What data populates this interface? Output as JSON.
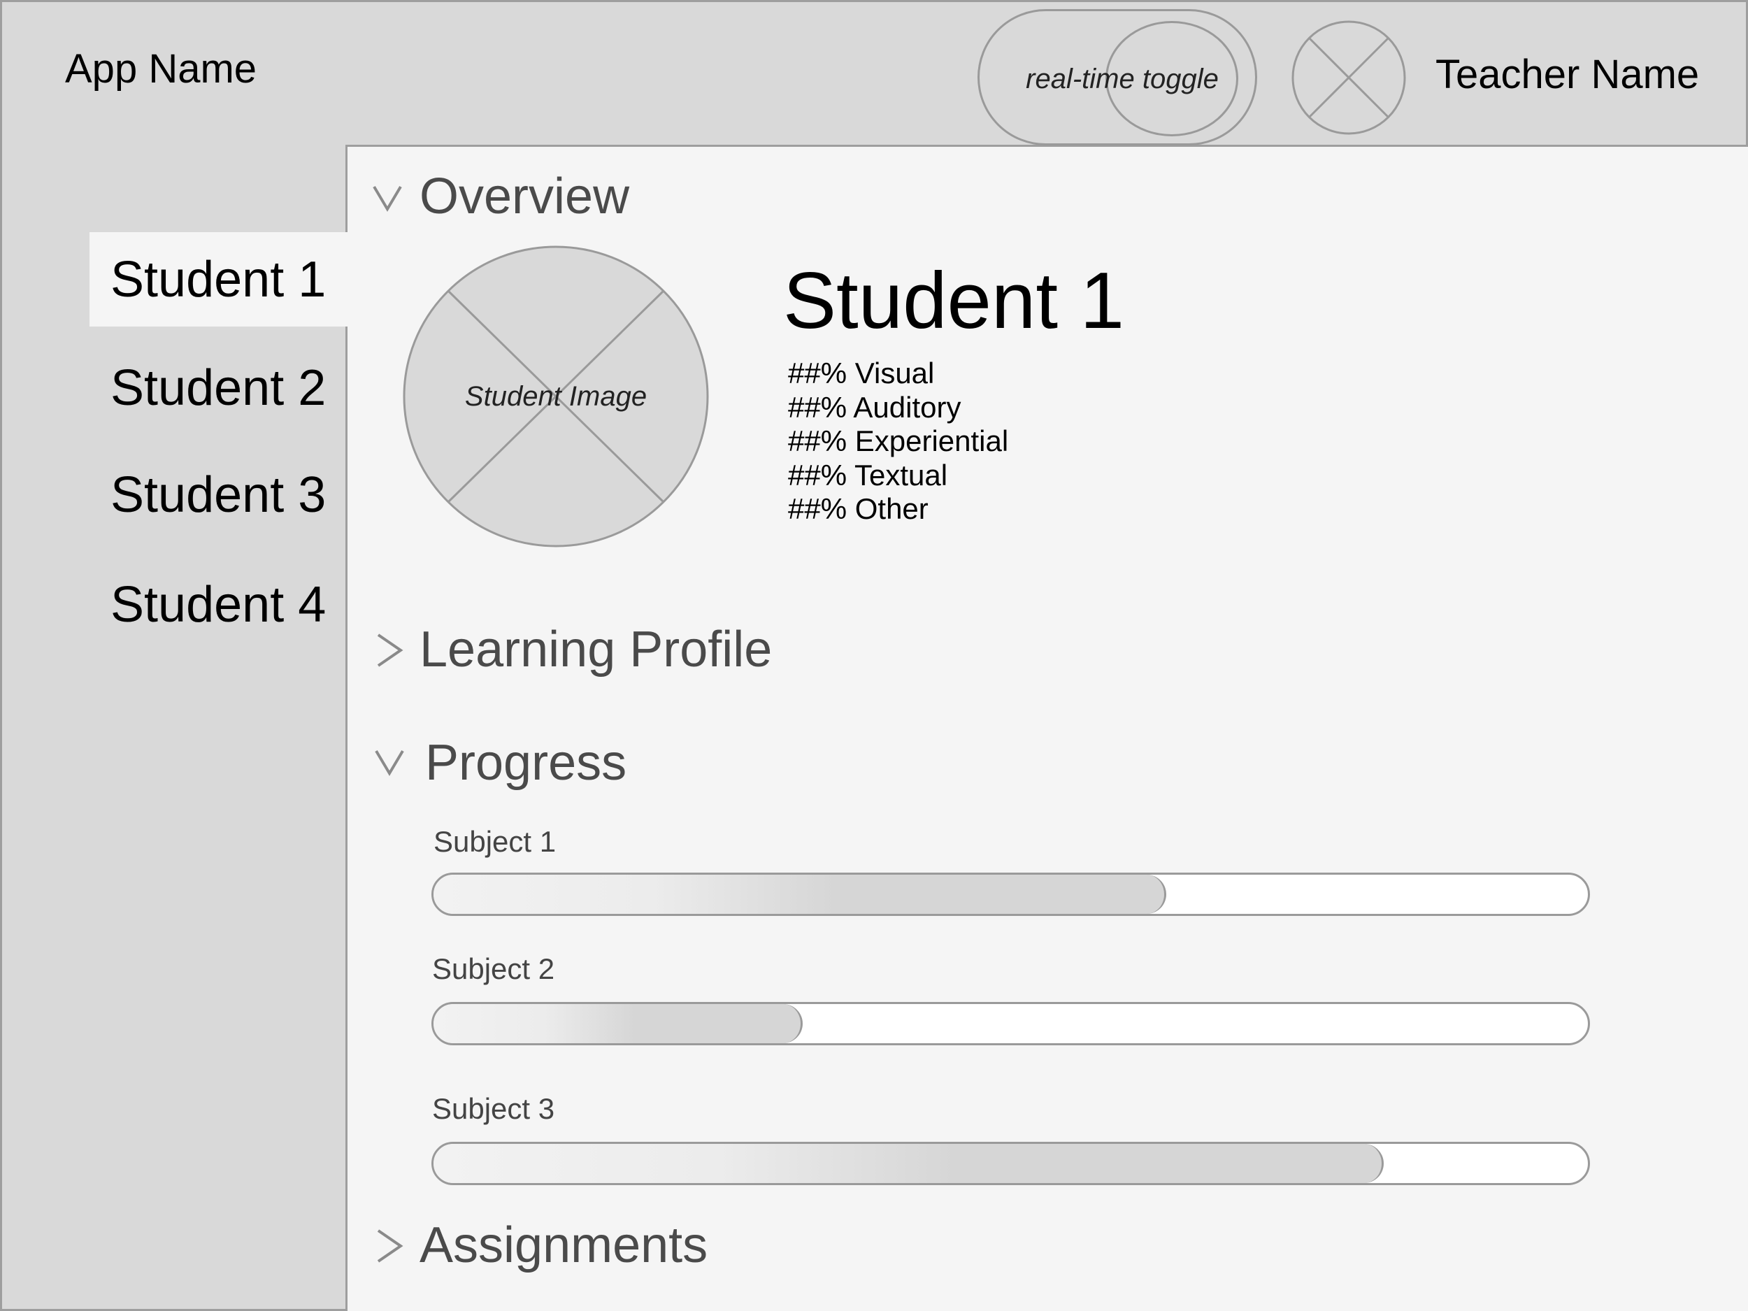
{
  "header": {
    "app_name": "App Name",
    "toggle_label": "real-time toggle",
    "teacher_name": "Teacher Name",
    "teacher_avatar_icon": "avatar-placeholder-icon"
  },
  "sidebar": {
    "items": [
      {
        "label": "Student 1",
        "active": true
      },
      {
        "label": "Student 2",
        "active": false
      },
      {
        "label": "Student 3",
        "active": false
      },
      {
        "label": "Student 4",
        "active": false
      }
    ]
  },
  "overview": {
    "title": "Overview",
    "expanded": true,
    "image_label": "Student Image",
    "student_name": "Student 1",
    "stats": [
      "##% Visual",
      "##% Auditory",
      "##% Experiential",
      "##% Textual",
      "##% Other"
    ]
  },
  "learning_profile": {
    "title": "Learning Profile",
    "expanded": false
  },
  "progress": {
    "title": "Progress",
    "expanded": true,
    "subjects": [
      {
        "label": "Subject 1",
        "value": 0.635
      },
      {
        "label": "Subject 2",
        "value": 0.32
      },
      {
        "label": "Subject 3",
        "value": 0.823
      }
    ]
  },
  "assignments": {
    "title": "Assignments",
    "expanded": false
  },
  "icons": {
    "expanded": "chevron-down-icon",
    "collapsed": "chevron-right-icon"
  },
  "colors": {
    "header_bg": "#d9d9d9",
    "content_bg": "#f5f5f5",
    "border": "#9e9e9e",
    "bar_fill": "#d6d6d6"
  }
}
